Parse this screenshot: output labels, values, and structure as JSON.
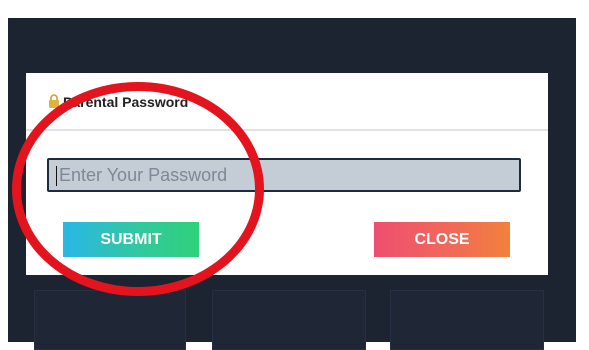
{
  "dialog": {
    "title": "Parental Password",
    "password_placeholder": "Enter Your Password",
    "submit_label": "SUBMIT",
    "close_label": "CLOSE"
  },
  "background_tiles": [
    "",
    "",
    ""
  ],
  "colors": {
    "screen_background": "#1c2331",
    "dialog_background": "#ffffff",
    "input_background": "#c4ccd5",
    "submit_gradient_start": "#2ab7e6",
    "submit_gradient_end": "#2ed17b",
    "close_gradient_start": "#ee4f70",
    "close_gradient_end": "#f2813b",
    "annotation_circle": "#e3141d"
  },
  "icons": {
    "title_icon": "lock-icon"
  }
}
